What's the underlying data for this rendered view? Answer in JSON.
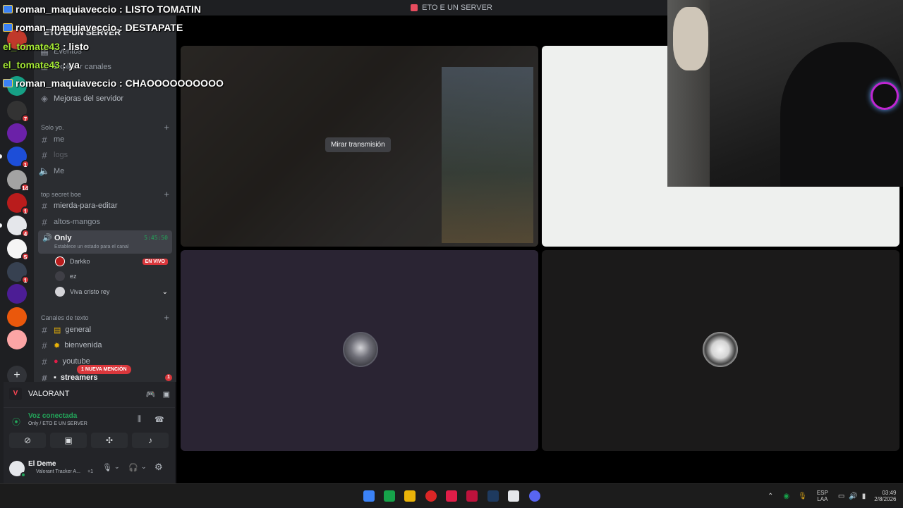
{
  "window": {
    "title": "ETO E UN SERVER"
  },
  "chat_overlay": [
    {
      "user": "roman_maquiaveccio",
      "sep": " : ",
      "message": "LISTO TOMATIN"
    },
    {
      "user": "roman_maquiaveccio",
      "sep": " : ",
      "message": "DESTAPATE"
    },
    {
      "user": "el_tomate43",
      "sep": " : ",
      "message": "listo"
    },
    {
      "user": "el_tomate43",
      "sep": " : ",
      "message": "ya"
    },
    {
      "user": "roman_maquiaveccio",
      "sep": " : ",
      "message": "CHAOOOOOOOOOO"
    }
  ],
  "servers": [
    {
      "name": "server-1",
      "color": "#c0392b",
      "badge": "1"
    },
    {
      "name": "server-tms",
      "color": "#16a085",
      "badge": ""
    },
    {
      "name": "server-3",
      "color": "#333",
      "badge": "7"
    },
    {
      "name": "server-4",
      "color": "#6b21a8",
      "badge": ""
    },
    {
      "name": "server-5",
      "color": "#1d4ed8",
      "badge": "1"
    },
    {
      "name": "server-6",
      "color": "#a3a3a3",
      "badge": "14"
    },
    {
      "name": "server-7",
      "color": "#b91c1c",
      "badge": "1"
    },
    {
      "name": "server-8",
      "color": "#e5e7eb",
      "badge": "4"
    },
    {
      "name": "server-9",
      "color": "#f5f5f5",
      "badge": "5"
    },
    {
      "name": "server-10",
      "color": "#374151",
      "badge": "1"
    },
    {
      "name": "server-11",
      "color": "#4c1d95",
      "badge": ""
    },
    {
      "name": "server-lml",
      "color": "#ea580c",
      "badge": ""
    },
    {
      "name": "server-13",
      "color": "#fca5a5",
      "badge": ""
    }
  ],
  "sidebar": {
    "server_name": "ETO E UN SERVER",
    "top_items": [
      {
        "label": "Eventos"
      },
      {
        "label": "Explorar canales"
      },
      {
        "label": "Mejoras del servidor"
      }
    ],
    "categories": {
      "solo": {
        "label": "Solo yo."
      },
      "topsecret": {
        "label": "top secret boe"
      },
      "texto": {
        "label": "Canales de texto"
      }
    },
    "solo_channels": [
      {
        "label": "me"
      },
      {
        "label": "logs"
      },
      {
        "label": "Me"
      }
    ],
    "topsecret_channels": [
      {
        "label": "mierda-para-editar"
      },
      {
        "label": "altos-mangos"
      }
    ],
    "voice_active": {
      "name": "Only",
      "timer": "5:45:50",
      "status": "Establece un estado para el canal"
    },
    "voice_users": [
      {
        "name": "Darkko",
        "live": "EN VIVO"
      },
      {
        "name": "ez",
        "live": ""
      },
      {
        "name": "Viva cristo rey",
        "live": ""
      }
    ],
    "text_channels": [
      {
        "label": "general"
      },
      {
        "label": "bienvenida"
      },
      {
        "label": "youtube"
      },
      {
        "label": "streamers"
      }
    ],
    "mention_badge": "1 NUEVA MENCIÓN",
    "streamers_badge": "1"
  },
  "activity": {
    "game": "VALORANT",
    "voice_status": "Voz conectada",
    "voice_location": "Only / ETO E UN SERVER"
  },
  "user": {
    "name": "El Deme",
    "status": "Valorant Tracker A...",
    "extra": "+1"
  },
  "stage": {
    "watch_stream": "Mirar transmisión"
  },
  "taskbar": {
    "lang": "ESP",
    "lang2": "LAA",
    "time": "03:49",
    "date": "2/8/2026"
  }
}
